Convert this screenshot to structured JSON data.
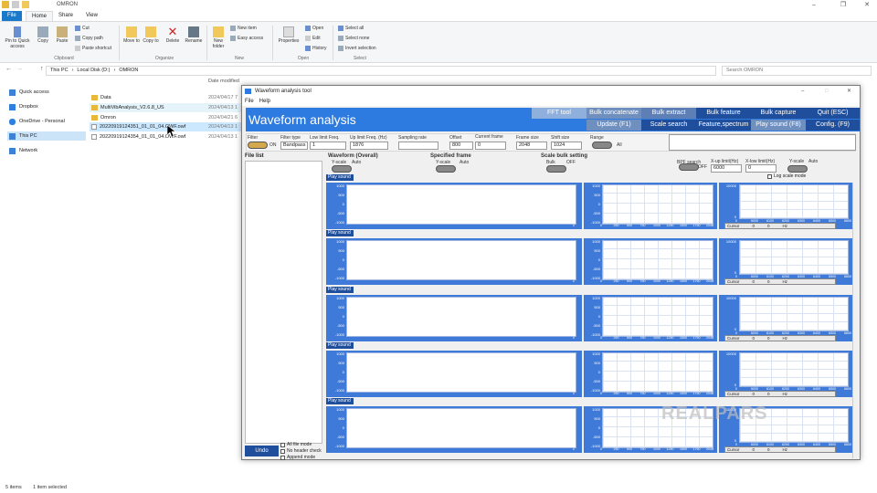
{
  "explorer": {
    "title": "OMRON",
    "tabs": [
      "File",
      "Home",
      "Share",
      "View"
    ],
    "ribbon": {
      "pin": "Pin to Quick access",
      "copy": "Copy",
      "paste": "Paste",
      "cut": "Cut",
      "copy_path": "Copy path",
      "paste_shortcut": "Paste shortcut",
      "move_to": "Move to",
      "copy_to": "Copy to",
      "delete": "Delete",
      "rename": "Rename",
      "new_folder": "New folder",
      "new_item": "New item",
      "easy_access": "Easy access",
      "properties": "Properties",
      "open": "Open",
      "edit": "Edit",
      "history": "History",
      "select_all": "Select all",
      "select_none": "Select none",
      "invert_selection": "Invert selection",
      "groups": [
        "Clipboard",
        "Organize",
        "New",
        "Open",
        "Select"
      ]
    },
    "address": [
      "This PC",
      "Local Disk (D:)",
      "OMRON"
    ],
    "search_placeholder": "Search OMRON",
    "nav": [
      "Quick access",
      "Dropbox",
      "OneDrive - Personal",
      "This PC",
      "Network"
    ],
    "col_date": "Date modified",
    "files": [
      {
        "name": "Data",
        "date": "2024/04/17 7"
      },
      {
        "name": "MultiVibAnalysis_V2.6.8_US",
        "date": "2024/04/13 1"
      },
      {
        "name": "Omron",
        "date": "2024/04/21 6"
      },
      {
        "name": "20220919124351_01_01_04.OWF.owf",
        "date": "2024/04/13 1"
      },
      {
        "name": "20220919124354_01_01_04.OWF.owf",
        "date": "2024/04/13 1"
      }
    ],
    "status_items": "5 items",
    "status_selected": "1 item selected"
  },
  "app": {
    "title": "Waveform analysis tool",
    "menu": [
      "File",
      "Help"
    ],
    "header": "Waveform analysis",
    "buttons_top": [
      "FFT tool",
      "Bulk concatenate",
      "Bulk extract",
      "Bulk feature",
      "Bulk capture",
      "Quit (ESC)"
    ],
    "buttons_bottom": [
      "Update (F1)",
      "Scale search",
      "Feature,spectrum",
      "Play sound (F8)",
      "Config. (F9)"
    ],
    "params": {
      "filter": "Filter",
      "on": "ON",
      "filter_type": "Filter type",
      "filter_type_val": "Bandpass",
      "low_limit": "Low limit Freq.",
      "low_val": "1",
      "up_limit": "Up limit Freq. (Hz)",
      "up_val": "1876",
      "sampling": "Sampling rate",
      "offset": "Offset",
      "offset_val": "800",
      "current_frame": "Current frame",
      "frame_val": "0",
      "frame_size": "Frame size",
      "frame_size_val": "2048",
      "shift_size": "Shift size",
      "shift_val": "1024",
      "range": "Range",
      "range_val": "All"
    },
    "file_list": "File list",
    "waveform_overall": "Waveform (Overall)",
    "specified_frame": "Specified frame",
    "scale_bulk": "Scale bulk setting",
    "yscale": "Y-scale",
    "auto": "Auto",
    "bulk": "Bulk",
    "off": "OFF",
    "bpf_search": "BPF search",
    "xup": "X-up limit(Hz)",
    "xup_val": "6000",
    "xlow": "X-low limit(Hz)",
    "xlow_val": "0",
    "log_scale": "Log scale mode",
    "play_sound": "Play sound",
    "undo": "Undo",
    "checks": [
      "All file mode",
      "No header check",
      "Append mode"
    ],
    "cursor": "Cursor",
    "cursor_vals": [
      "0",
      "0"
    ],
    "hz": "Hz",
    "y_ticks": [
      "1000",
      "500",
      "0",
      "-500",
      "-1000"
    ],
    "x_wave_end": "0",
    "x_frame": [
      "0",
      "250",
      "500",
      "750",
      "1000",
      "1250",
      "1500",
      "1750",
      "2048"
    ],
    "y_spec": [
      "10000",
      "0"
    ],
    "x_spec": [
      "0",
      "6000",
      "6100",
      "6200",
      "6300",
      "6400",
      "6500",
      "6600"
    ],
    "watermark": "REALPARS"
  }
}
